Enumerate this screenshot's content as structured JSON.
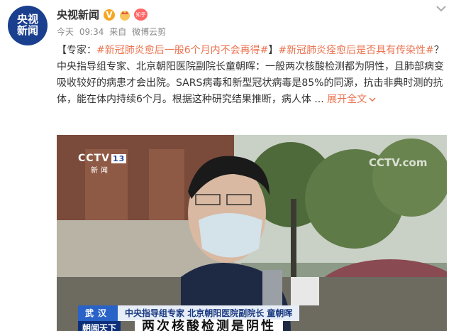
{
  "account": {
    "avatar_line1": "央视",
    "avatar_line2": "新闻",
    "name": "央视新闻",
    "verified_mark": "V",
    "badge_label": "知乎"
  },
  "meta": {
    "date": "今天",
    "time": "09:34",
    "source_prefix": "来自",
    "source": "微博云剪"
  },
  "post": {
    "prefix": "【专家：",
    "topic1": "#新冠肺炎愈后一般6个月内不会再得#",
    "mid": "】",
    "topic2": "#新冠肺炎痊愈后是否具有传染性#",
    "body": "？中央指导组专家、北京朝阳医院副院长童朝晖：一般两次核酸检测都为阴性，且肺部病变吸收较好的病患才会出院。SARS病毒和新型冠状病毒是85%的同源，抗击非典时测的抗体，能在体内持续6个月。根据这种研究结果推断，病人体 ...",
    "expand_label": "展开全文"
  },
  "video": {
    "channel_logo": "CCTV",
    "channel_number": "13",
    "channel_sub": "新闻",
    "watermark": "CCTV.com",
    "location": "武汉",
    "speaker": "中央指导组专家 北京朝阳医院副院长 童朝晖",
    "program": "朝闻天下",
    "headline": "两次核酸检测是阴性"
  },
  "colors": {
    "link": "#eb7350",
    "avatar_bg": "#1b3f8f",
    "lower_bar": "#1e4aa0"
  }
}
